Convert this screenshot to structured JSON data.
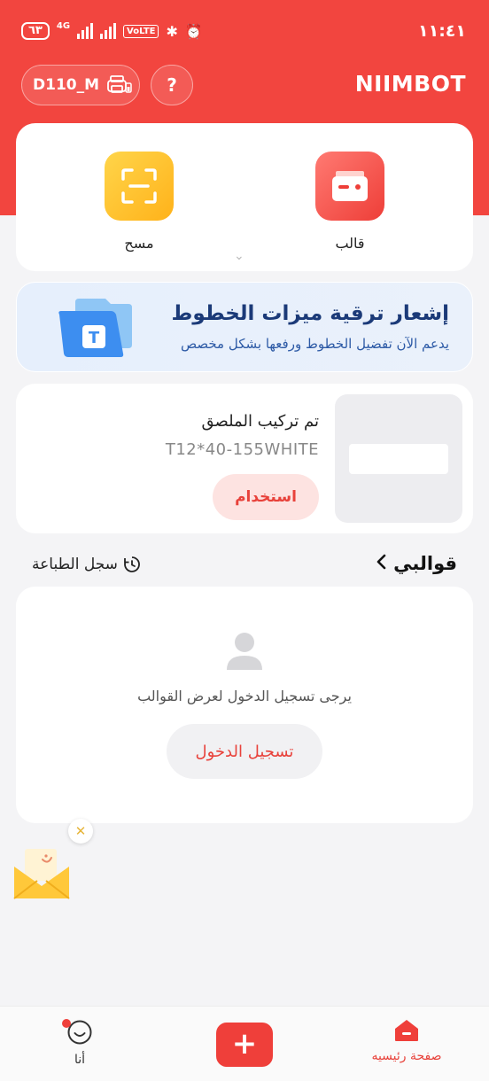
{
  "status_bar": {
    "battery": "٦٣",
    "network": "4G",
    "volte": "VoLTE",
    "time": "١١:٤١"
  },
  "header": {
    "device_name": "D110_M",
    "help_label": "?",
    "logo": "NIIMBOT",
    "accent_color": "#f2453f"
  },
  "quick_actions": [
    {
      "label": "قالب",
      "icon": "template-icon"
    },
    {
      "label": "مسح",
      "icon": "scan-icon"
    }
  ],
  "banner": {
    "title": "إشعار ترقية ميزات الخطوط",
    "subtitle": "يدعم الآن تفضيل الخطوط ورفعها بشكل مخصص",
    "icon": "font-folder-icon"
  },
  "label_card": {
    "status": "تم تركيب الملصق",
    "code": "T12*40-155WHITE",
    "use_button": "استخدام"
  },
  "sections": {
    "my_templates": "قوالبي",
    "print_history": "سجل الطباعة"
  },
  "login_card": {
    "message": "يرجى تسجيل الدخول لعرض القوالب",
    "button": "تسجيل الدخول"
  },
  "bottom_nav": {
    "home": "صفحة رئيسيه",
    "add": "+",
    "me": "أنا"
  }
}
